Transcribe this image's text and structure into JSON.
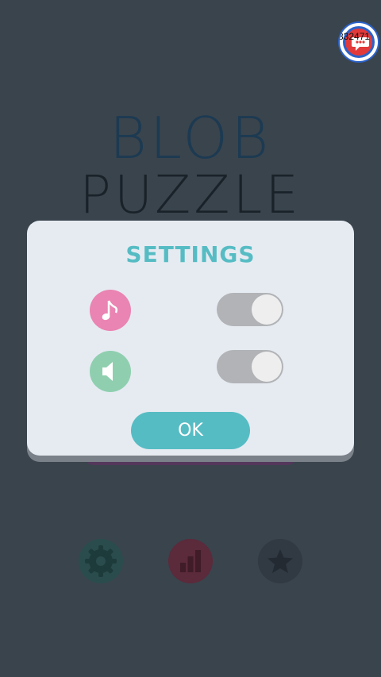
{
  "background_title": {
    "line1": "BLOB",
    "line2": "PUZZLE"
  },
  "badge": {
    "text": "832471",
    "icon": "chat-bubble-icon"
  },
  "bottom_bar": [
    {
      "icon": "gear-icon",
      "color": "#2a4c4c"
    },
    {
      "icon": "bar-chart-icon",
      "color": "#5b2a3b"
    },
    {
      "icon": "star-icon",
      "color": "#313943"
    }
  ],
  "settings_dialog": {
    "title": "SETTINGS",
    "rows": [
      {
        "icon": "music-note-icon",
        "icon_color": "#ea84b2",
        "toggle_on": true
      },
      {
        "icon": "speaker-icon",
        "icon_color": "#8fcfaf",
        "toggle_on": true
      }
    ],
    "ok_label": "OK"
  },
  "colors": {
    "background": "#3a444d",
    "accent": "#56bcc4",
    "dialog": "#e6ebf2"
  }
}
